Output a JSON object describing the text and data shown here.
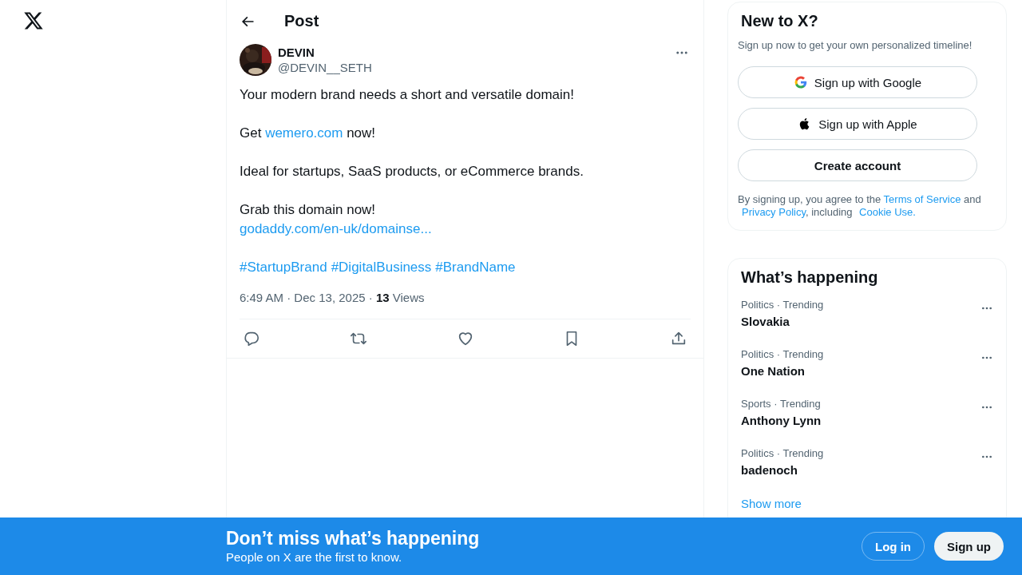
{
  "header": {
    "title": "Post"
  },
  "post": {
    "author": {
      "name": "DEVIN",
      "handle": "@DEVIN__SETH"
    },
    "paragraphs": [
      {
        "lines": [
          [
            {
              "kind": "text",
              "text": "Your modern brand needs a short and versatile domain!"
            }
          ]
        ]
      },
      {
        "lines": [
          [
            {
              "kind": "text",
              "text": "Get "
            },
            {
              "kind": "link",
              "text": "wemero.com"
            },
            {
              "kind": "text",
              "text": " now!"
            }
          ]
        ]
      },
      {
        "lines": [
          [
            {
              "kind": "text",
              "text": "Ideal for startups, SaaS products, or eCommerce brands."
            }
          ]
        ]
      },
      {
        "lines": [
          [
            {
              "kind": "text",
              "text": "Grab this domain now!"
            }
          ],
          [
            {
              "kind": "link",
              "text": "godaddy.com/en-uk/domainse..."
            }
          ]
        ]
      },
      {
        "lines": [
          [
            {
              "kind": "link",
              "text": "#StartupBrand"
            },
            {
              "kind": "link",
              "text": "#DigitalBusiness"
            },
            {
              "kind": "link",
              "text": "#BrandName"
            }
          ]
        ]
      }
    ],
    "meta": "6:49 AM · Dec 13, 2025 · **13** Views"
  },
  "signup": {
    "title": "New to X?",
    "subtitle": "Sign up now to get your own personalized timeline!",
    "buttons": [
      {
        "kind": "google",
        "label": "Sign up with Google"
      },
      {
        "kind": "apple",
        "label": "Sign up with Apple"
      },
      {
        "kind": "plain",
        "label": "Create account"
      }
    ],
    "legal": [
      {
        "kind": "text",
        "text": "By signing up, you agree to the "
      },
      {
        "kind": "link",
        "text": "Terms of Service"
      },
      {
        "kind": "text",
        "text": " and "
      },
      {
        "kind": "link",
        "text": "Privacy Policy"
      },
      {
        "kind": "text",
        "text": ", including "
      },
      {
        "kind": "link",
        "text": "Cookie Use."
      }
    ]
  },
  "trends": {
    "title": "What’s happening",
    "items": [
      {
        "category": "Politics · Trending",
        "name": "Slovakia"
      },
      {
        "category": "Politics · Trending",
        "name": "One Nation"
      },
      {
        "category": "Sports · Trending",
        "name": "Anthony Lynn"
      },
      {
        "category": "Politics · Trending",
        "name": "badenoch"
      }
    ],
    "show_more": "Show more"
  },
  "banner": {
    "title": "Don’t miss what’s happening",
    "subtitle": "People on X are the first to know.",
    "buttons": [
      {
        "kind": "outline",
        "label": "Log in"
      },
      {
        "kind": "filled",
        "label": "Sign up"
      }
    ]
  }
}
